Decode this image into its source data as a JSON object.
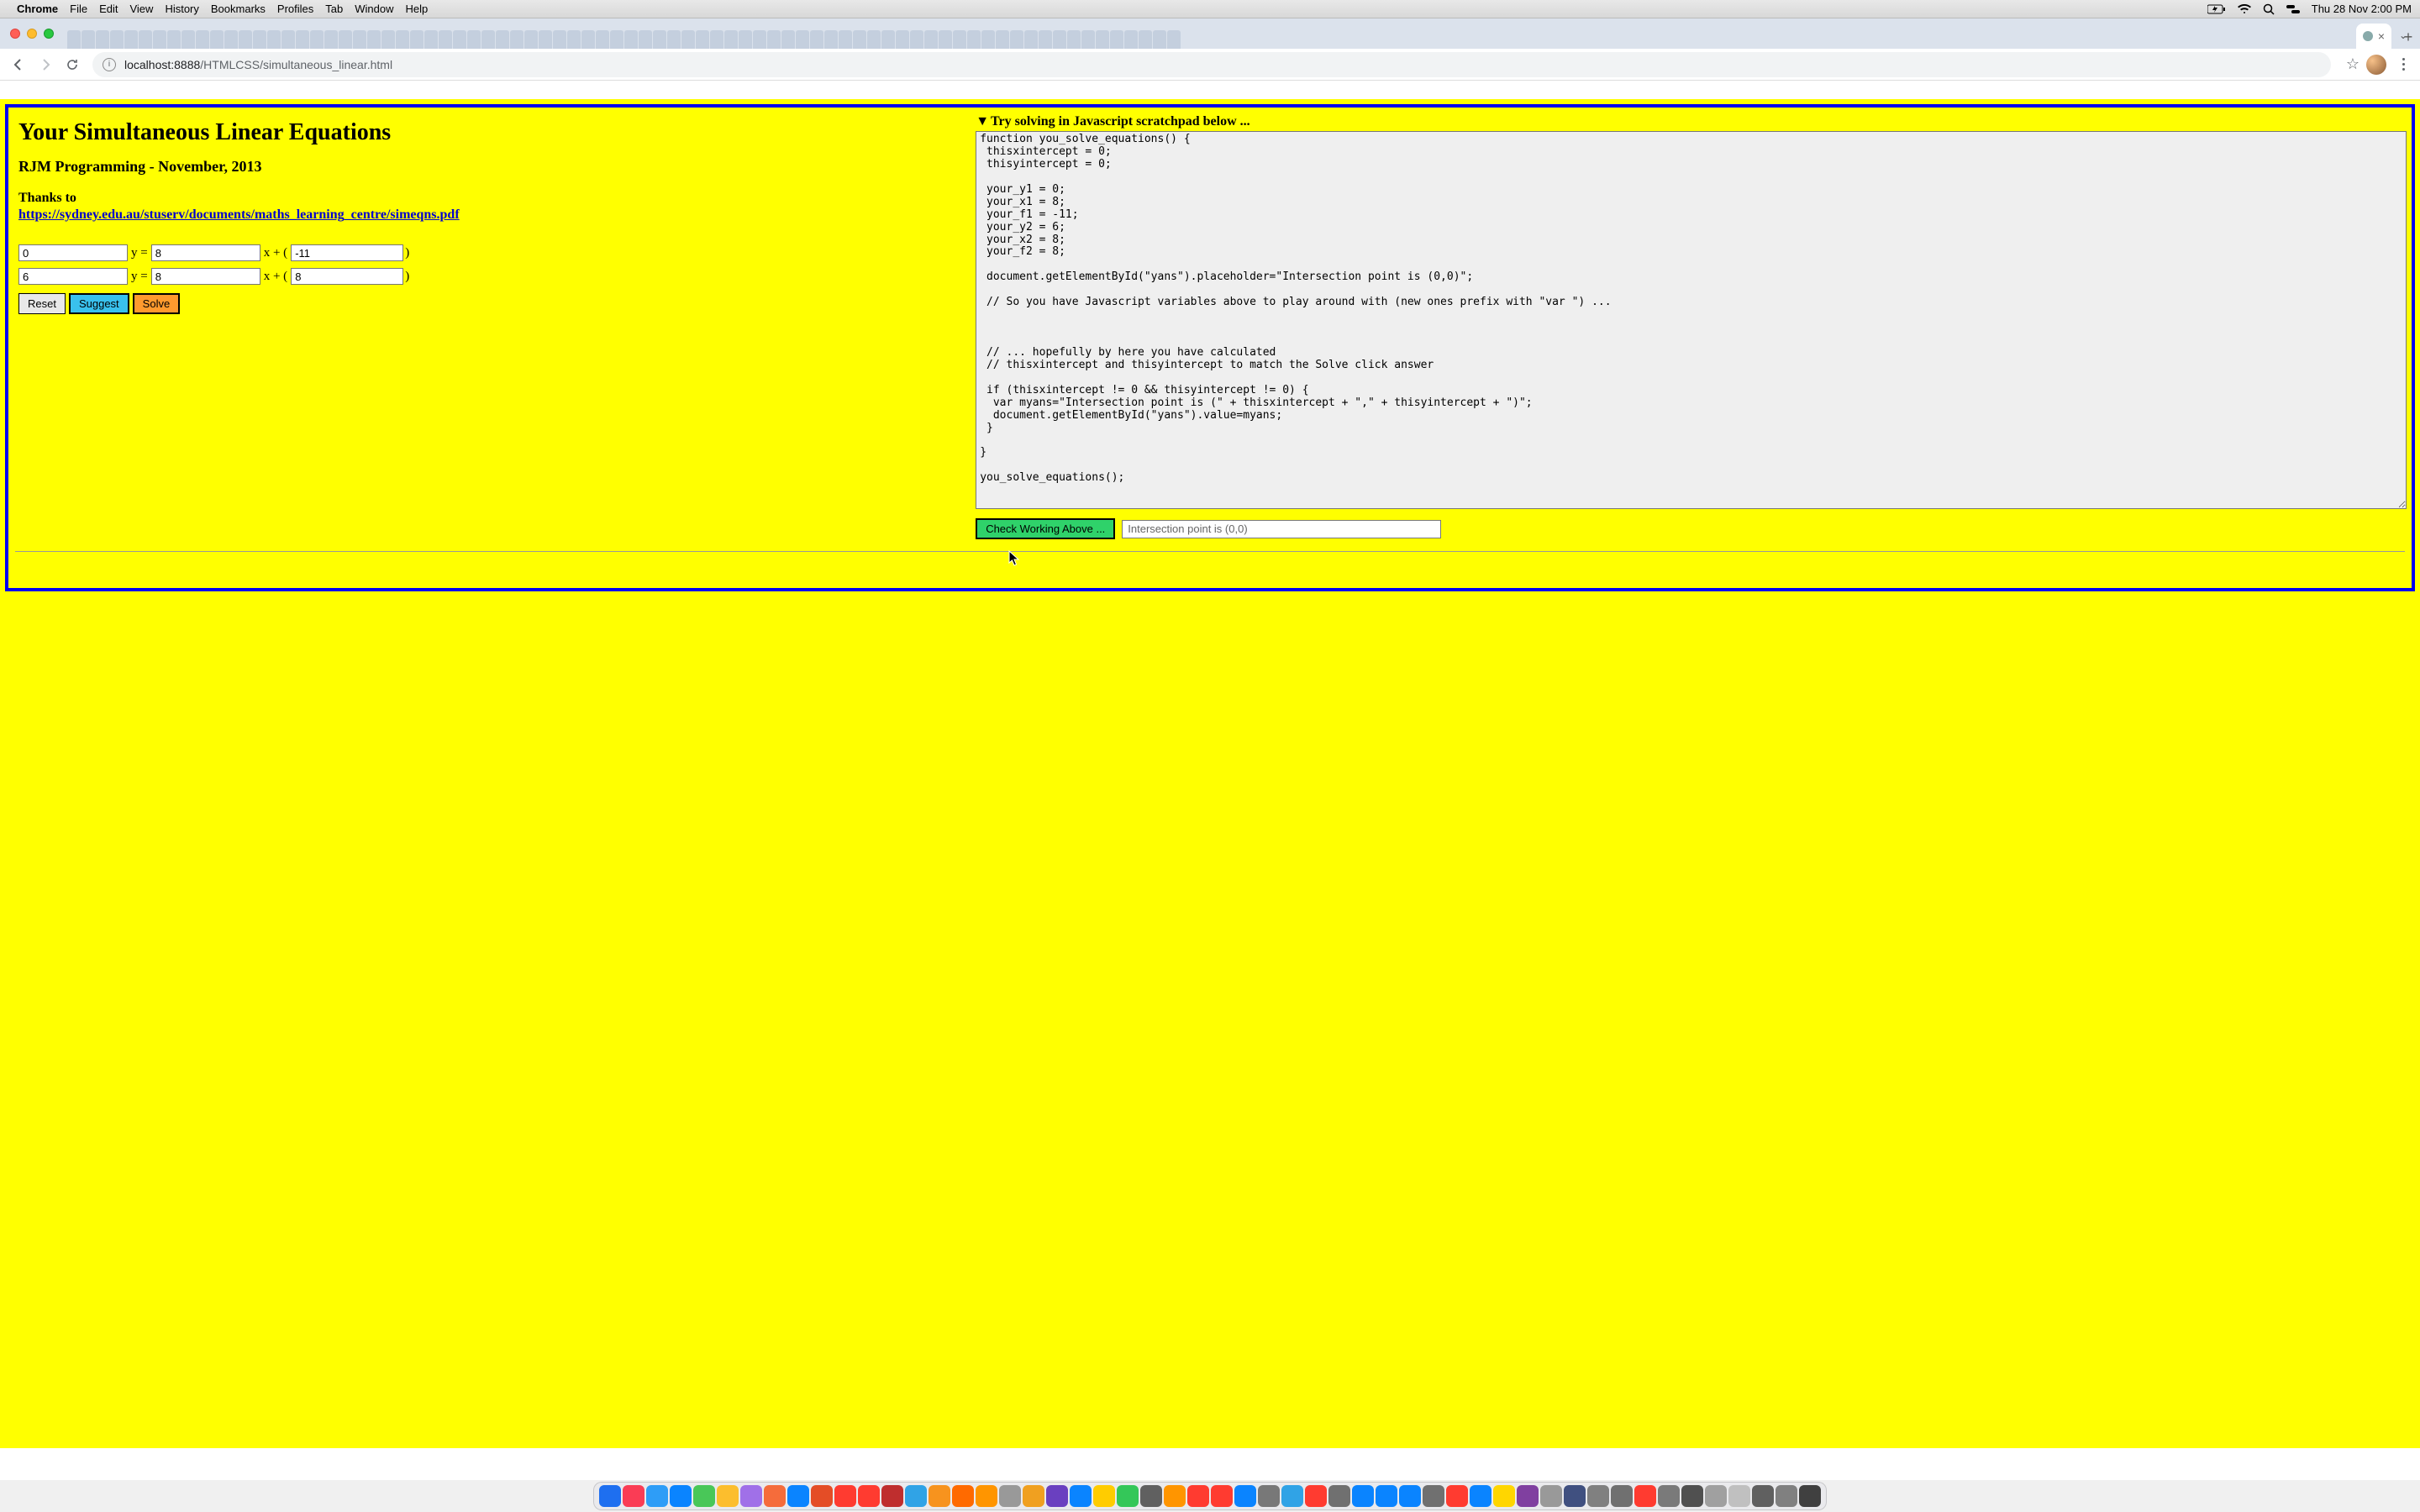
{
  "menubar": {
    "app": "Chrome",
    "items": [
      "File",
      "Edit",
      "View",
      "History",
      "Bookmarks",
      "Profiles",
      "Tab",
      "Window",
      "Help"
    ],
    "clock": "Thu 28 Nov  2:00 PM"
  },
  "browser": {
    "url_host": "localhost:8888",
    "url_path": "/HTMLCSS/simultaneous_linear.html",
    "close_x": "×",
    "plus": "+",
    "chevron": "⌄"
  },
  "page": {
    "title": "Your Simultaneous Linear Equations",
    "subtitle": "RJM Programming - November, 2013",
    "thanks_label": "Thanks to",
    "thanks_link": "https://sydney.edu.au/stuserv/documents/maths_learning_centre/simeqns.pdf",
    "eq1": {
      "a": "0",
      "y_eq": "y = ",
      "b": "8",
      "x_plus": "x + (",
      "c": "-11",
      "rparen": ")"
    },
    "eq2": {
      "a": "6",
      "y_eq": "y = ",
      "b": "8",
      "x_plus": "x + (",
      "c": "8",
      "rparen": ")"
    },
    "buttons": {
      "reset": "Reset",
      "suggest": "Suggest",
      "solve": "Solve"
    },
    "scratch_header": "Try solving in Javascript scratchpad below ...",
    "scratch_tri": "▼",
    "code": "function you_solve_equations() {\n thisxintercept = 0;\n thisyintercept = 0;\n\n your_y1 = 0;\n your_x1 = 8;\n your_f1 = -11;\n your_y2 = 6;\n your_x2 = 8;\n your_f2 = 8;\n\n document.getElementById(\"yans\").placeholder=\"Intersection point is (0,0)\";\n\n // So you have Javascript variables above to play around with (new ones prefix with \"var \") ...\n\n\n\n // ... hopefully by here you have calculated\n // thisxintercept and thisyintercept to match the Solve click answer\n\n if (thisxintercept != 0 && thisyintercept != 0) {\n  var myans=\"Intersection point is (\" + thisxintercept + \",\" + thisyintercept + \")\";\n  document.getElementById(\"yans\").value=myans;\n }\n\n}\n\nyou_solve_equations();",
    "check_label": "Check Working Above ...",
    "ans_placeholder": "Intersection point is (0,0)"
  },
  "dock_colors": [
    "#1e6ff0",
    "#fa3c55",
    "#2e9df7",
    "#0a84ff",
    "#49c758",
    "#fcbe2d",
    "#a070e8",
    "#f56c3b",
    "#0a84ff",
    "#e44d26",
    "#ff3b30",
    "#ff3b30",
    "#bf2e2e",
    "#30a3e6",
    "#f7931e",
    "#ff6a00",
    "#ff9500",
    "#999999",
    "#f0a020",
    "#6a40c0",
    "#0a84ff",
    "#ffcc00",
    "#34c759",
    "#606060",
    "#ff9500",
    "#ff3b30",
    "#ff3b30",
    "#0a84ff",
    "#787878",
    "#30a3e6",
    "#ff3b30",
    "#707070",
    "#0a84ff",
    "#0a84ff",
    "#0a84ff",
    "#707070",
    "#ff3b30",
    "#0a84ff",
    "#ffd600",
    "#8040a0",
    "#999999",
    "#405080",
    "#808080",
    "#707070",
    "#ff3b30",
    "#7a7a7a",
    "#505050",
    "#a0a0a0",
    "#c0c0c0",
    "#606060",
    "#808080",
    "#404040"
  ]
}
